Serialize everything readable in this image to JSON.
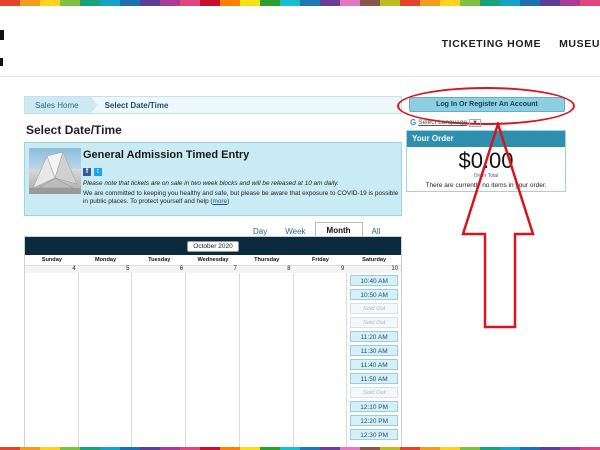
{
  "top_nav": {
    "items": [
      "TICKETING HOME",
      "MUSEU"
    ]
  },
  "breadcrumb": {
    "home_label": "Sales Home",
    "current_label": "Select Date/Time"
  },
  "page": {
    "title": "Select Date/Time"
  },
  "event": {
    "title": "General Admission Timed Entry",
    "note": "Please note that tickets are on sale in two week blocks and will be released at 10 am daily.",
    "commitment_text": "We are committed to keeping you healthy and safe, but please be aware that exposure to COVID-19 is possible in public places. To protect yourself and help (",
    "more_link": "more",
    "commitment_tail": ")"
  },
  "view_tabs": {
    "items": [
      "Day",
      "Week",
      "Month",
      "All"
    ],
    "active": "Month"
  },
  "calendar": {
    "month_label": "October 2020",
    "weekdays": [
      "Sunday",
      "Monday",
      "Tuesday",
      "Wednesday",
      "Thursday",
      "Friday",
      "Saturday"
    ],
    "dates": [
      "4",
      "5",
      "6",
      "7",
      "8",
      "9",
      "10"
    ],
    "saturday_slots": [
      {
        "label": "10:40 AM",
        "status": "available"
      },
      {
        "label": "10:50 AM",
        "status": "available"
      },
      {
        "label": "Sold Out",
        "status": "sold_out"
      },
      {
        "label": "Sold Out",
        "status": "sold_out"
      },
      {
        "label": "11:20 AM",
        "status": "available"
      },
      {
        "label": "11:30 AM",
        "status": "available"
      },
      {
        "label": "11:40 AM",
        "status": "available"
      },
      {
        "label": "11:50 AM",
        "status": "available"
      },
      {
        "label": "Sold Out",
        "status": "sold_out"
      },
      {
        "label": "12:10 PM",
        "status": "available"
      },
      {
        "label": "12:20 PM",
        "status": "available"
      },
      {
        "label": "12:30 PM",
        "status": "available"
      }
    ]
  },
  "account": {
    "login_label": "Log In Or Register An Account"
  },
  "translate": {
    "label": "Select Language",
    "arrow": "▼"
  },
  "order": {
    "heading": "Your Order",
    "total": "$0.00",
    "total_label": "Order Total",
    "empty_message": "There are currently no items in your order."
  },
  "colors": {
    "annotation_red": "#d8151d",
    "accent_blue": "#2e8fae",
    "calendar_header": "#0b2a3d"
  },
  "strip_colors": [
    "#e4412b",
    "#f29b1d",
    "#ffd21f",
    "#7cc142",
    "#1aa37a",
    "#14a3c7",
    "#1c6fb5",
    "#5a3f99",
    "#a63c95",
    "#e0457b",
    "#c8102e",
    "#ff7f00",
    "#f7e017",
    "#2ca02c",
    "#17becf",
    "#1f77b4",
    "#6a3d9a",
    "#e377c2",
    "#8c564b",
    "#bcbd22",
    "#e4412b",
    "#f29b1d",
    "#ffd21f",
    "#7cc142",
    "#1aa37a",
    "#14a3c7",
    "#1c6fb5",
    "#5a3f99",
    "#a63c95",
    "#e0457b"
  ]
}
